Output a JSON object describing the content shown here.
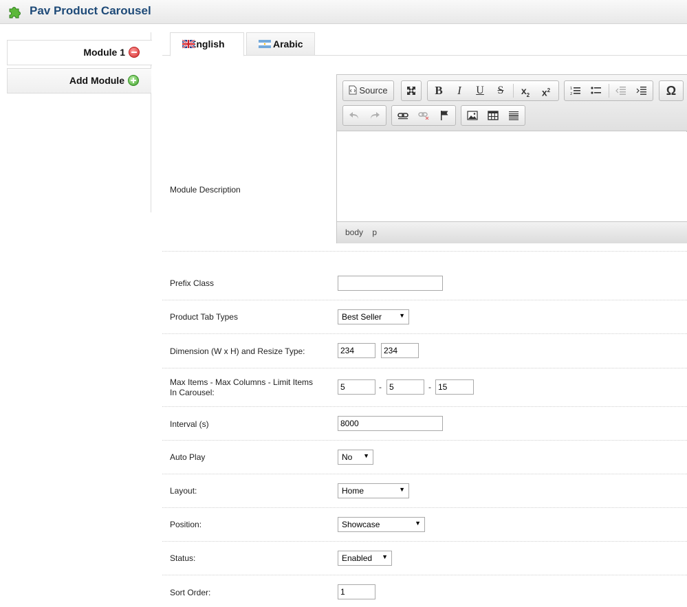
{
  "header": {
    "title": "Pav Product Carousel",
    "icon": "puzzle-icon"
  },
  "modules": {
    "items": [
      {
        "label": "Module 1",
        "action_icon": "remove-icon"
      }
    ],
    "add_label": "Add Module"
  },
  "languages": [
    {
      "label": "English",
      "icon": "uk-flag-icon",
      "active": true
    },
    {
      "label": "Arabic",
      "icon": "argentina-flag-icon",
      "active": false
    }
  ],
  "editor": {
    "label": "Module Description",
    "source_label": "Source",
    "path": [
      "body",
      "p"
    ]
  },
  "form": {
    "prefix_class": {
      "label": "Prefix Class",
      "value": ""
    },
    "product_tab_types": {
      "label": "Product Tab Types",
      "value": "Best Seller"
    },
    "dimension": {
      "label": "Dimension (W x H) and Resize Type:",
      "width": "234",
      "height": "234"
    },
    "max_items": {
      "label": "Max Items - Max Columns - Limit Items In Carousel:",
      "items": "5",
      "columns": "5",
      "limit": "15",
      "separator": "-"
    },
    "interval": {
      "label": "Interval (s)",
      "value": "8000"
    },
    "auto_play": {
      "label": "Auto Play",
      "value": "No"
    },
    "layout": {
      "label": "Layout:",
      "value": "Home"
    },
    "position": {
      "label": "Position:",
      "value": "Showcase"
    },
    "status": {
      "label": "Status:",
      "value": "Enabled"
    },
    "sort_order": {
      "label": "Sort Order:",
      "value": "1"
    }
  }
}
